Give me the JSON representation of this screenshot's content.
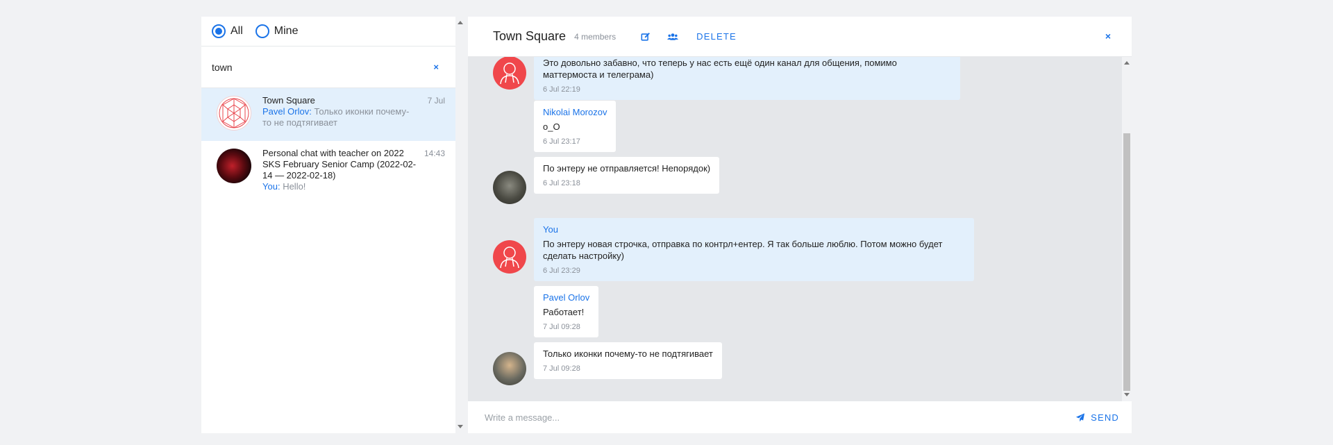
{
  "filters": {
    "all_label": "All",
    "mine_label": "Mine",
    "selected": "All"
  },
  "search": {
    "value": "town",
    "clear": "×"
  },
  "chats": [
    {
      "title": "Town Square",
      "sender": "Pavel Orlov:",
      "preview": "Только иконки почему-то не подтягивает",
      "time": "7 Jul"
    },
    {
      "title": "Personal chat with teacher on 2022 SKS February Senior Camp (2022-02-14 — 2022-02-18)",
      "sender": "You:",
      "preview": "Hello!",
      "time": "14:43"
    }
  ],
  "header": {
    "title": "Town Square",
    "members": "4 members",
    "edit_icon": "edit-icon",
    "members_icon": "users-icon",
    "delete_label": "DELETE",
    "close": "×"
  },
  "messages": [
    {
      "author": "",
      "text": "Это довольно забавно, что теперь у нас есть ещё один канал для общения, помимо маттермоста и телеграма)",
      "time": "6 Jul 22:19",
      "mine": true
    },
    {
      "author": "Nikolai Morozov",
      "text": "o_O",
      "time": "6 Jul 23:17",
      "mine": false
    },
    {
      "author": "",
      "text": "По энтеру не отправляется! Непорядок)",
      "time": "6 Jul 23:18",
      "mine": false
    },
    {
      "author": "You",
      "text": "По энтеру новая строчка, отправка по контрл+ентер. Я так больше люблю. Потом можно будет сделать настройку)",
      "time": "6 Jul 23:29",
      "mine": true
    },
    {
      "author": "Pavel Orlov",
      "text": "Работает!",
      "time": "7 Jul 09:28",
      "mine": false
    },
    {
      "author": "",
      "text": "Только иконки почему-то не подтягивает",
      "time": "7 Jul 09:28",
      "mine": false
    }
  ],
  "composer": {
    "placeholder": "Write a message...",
    "send_label": "SEND",
    "send_icon": "paper-plane-icon"
  },
  "colors": {
    "accent": "#1a73e8",
    "mine_bubble": "#e3f0fc",
    "avatar_red": "#f0474b"
  }
}
